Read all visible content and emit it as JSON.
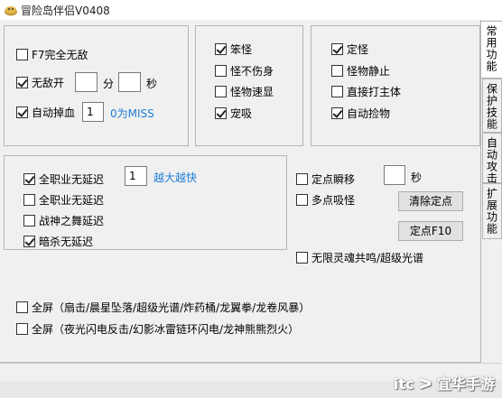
{
  "window": {
    "title": "冒险岛伴侣V0408"
  },
  "tabs": [
    {
      "label": "常用功能",
      "active": true
    },
    {
      "label": "保护技能",
      "active": false
    },
    {
      "label": "自动攻击",
      "active": false
    },
    {
      "label": "扩展功能",
      "active": false
    }
  ],
  "group1": {
    "f7": {
      "label": "F7完全无敌",
      "checked": false
    },
    "invincible": {
      "label": "无敌开",
      "checked": true,
      "min_value": "",
      "min_unit": "分",
      "sec_value": "",
      "sec_unit": "秒"
    },
    "auto_drop_hp": {
      "label": "自动掉血",
      "checked": true,
      "value": "1",
      "hint": "0为MISS"
    }
  },
  "group2": {
    "stupid_mob": {
      "label": "笨怪",
      "checked": true
    },
    "mob_no_damage": {
      "label": "怪不伤身",
      "checked": false
    },
    "mob_speed": {
      "label": "怪物速显",
      "checked": false
    },
    "pet_vacuum": {
      "label": "宠吸",
      "checked": true
    }
  },
  "group3": {
    "freeze_mob": {
      "label": "定怪",
      "checked": true
    },
    "mob_still": {
      "label": "怪物静止",
      "checked": false
    },
    "hit_boss": {
      "label": "直接打主体",
      "checked": false
    },
    "auto_loot": {
      "label": "自动捡物",
      "checked": true
    }
  },
  "group4": {
    "all_class_a": {
      "label": "全职业无延迟",
      "checked": true
    },
    "speed_value": "1",
    "speed_hint": "越大越快",
    "all_class_b": {
      "label": "全职业无延迟",
      "checked": false
    },
    "war_god": {
      "label": "战神之舞延迟",
      "checked": false
    },
    "assassin": {
      "label": "暗杀无延迟",
      "checked": true
    }
  },
  "right_tools": {
    "fixed_teleport": {
      "label": "定点瞬移",
      "checked": false,
      "value": "",
      "unit": "秒"
    },
    "multi_vacuum": {
      "label": "多点吸怪",
      "checked": false
    },
    "clear_point_button": "清除定点",
    "set_point_button": "定点F10",
    "infinite_resonance": {
      "label": "无限灵魂共鸣/超级光谱",
      "checked": false
    }
  },
  "fullscreen": {
    "row1": {
      "label": "全屏（扇击/晨星坠落/超级光谱/炸药桶/龙翼拳/龙卷风暴）",
      "checked": false
    },
    "row2": {
      "label": "全屏（夜光闪电反击/幻影冰雷链环闪电/龙神熊熊烈火）",
      "checked": false
    }
  },
  "watermark": "itc ᐳ 宜华手游"
}
